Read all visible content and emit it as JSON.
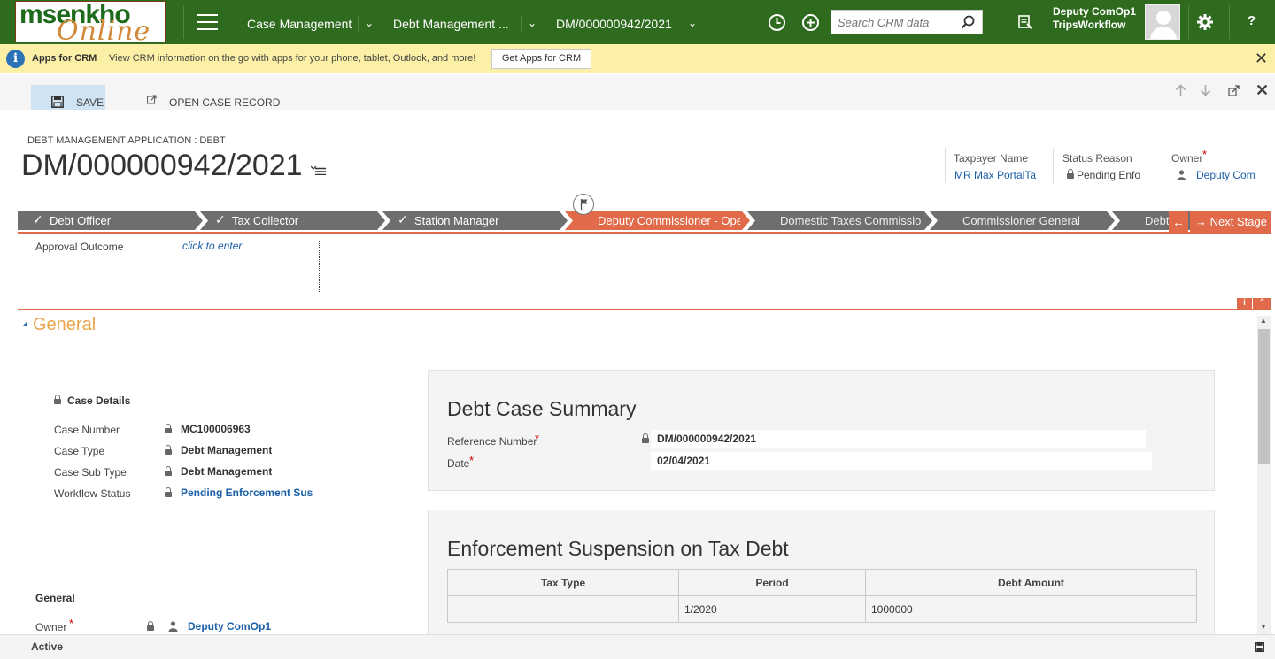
{
  "app": {
    "logo_line1": "msenkho",
    "logo_line2": "Online",
    "nav_items": [
      "Case Management",
      "Debt Management ...",
      "DM/000000942/2021"
    ],
    "search_placeholder": "Search CRM data",
    "user_name": "Deputy ComOp1",
    "user_org": "TripsWorkflow",
    "help_label": "?"
  },
  "infobar": {
    "title": "Apps for CRM",
    "message": "View CRM information on the go with apps for your phone, tablet, Outlook, and more!",
    "button": "Get Apps for CRM"
  },
  "commands": {
    "save": "SAVE",
    "open_case": "OPEN CASE RECORD"
  },
  "header": {
    "entity_type": "DEBT MANAGEMENT APPLICATION : DEBT",
    "title": "DM/000000942/2021",
    "fields": [
      {
        "label": "Taxpayer Name",
        "value": "MR Max PortalTa"
      },
      {
        "label": "Status Reason",
        "value": "Pending Enfo"
      },
      {
        "label": "Owner",
        "value": "Deputy Com"
      }
    ]
  },
  "process": {
    "stages": [
      {
        "label": "Debt Officer",
        "status": "completed"
      },
      {
        "label": "Tax Collector",
        "status": "completed"
      },
      {
        "label": "Station Manager",
        "status": "completed"
      },
      {
        "label": "Deputy Commissioner - Opera",
        "status": "active"
      },
      {
        "label": "Domestic Taxes Commissione",
        "status": "pending"
      },
      {
        "label": "Commissioner General",
        "status": "pending"
      },
      {
        "label": "Debt",
        "status": "pending"
      }
    ],
    "next_stage": "Next Stage",
    "approval_label": "Approval Outcome",
    "approval_value": "click to enter"
  },
  "colors": {
    "nav_bg": "#2f6b1f",
    "stage_gray": "#6e6e6e",
    "stage_active": "#e06a49",
    "section_accent": "#e9a54a",
    "link": "#1a5fa8"
  },
  "general": {
    "section_title": "General",
    "case_details_title": "Case Details",
    "case_details": [
      {
        "label": "Case Number",
        "value": "MC100006963"
      },
      {
        "label": "Case Type",
        "value": "Debt Management"
      },
      {
        "label": "Case Sub Type",
        "value": "Debt Management"
      },
      {
        "label": "Workflow Status",
        "value": "Pending Enforcement Sus"
      }
    ],
    "general2_title": "General",
    "owner_label": "Owner",
    "owner_value": "Deputy ComOp1"
  },
  "summary": {
    "title": "Debt Case Summary",
    "reference_label": "Reference Number",
    "reference_value": "DM/000000942/2021",
    "date_label": "Date",
    "date_value": "02/04/2021"
  },
  "enforcement": {
    "title": "Enforcement Suspension on Tax Debt",
    "columns": [
      "Tax Type",
      "Period",
      "Debt Amount"
    ],
    "rows": [
      [
        "",
        "1/2020",
        "1000000"
      ]
    ]
  },
  "footer": {
    "status": "Active"
  }
}
